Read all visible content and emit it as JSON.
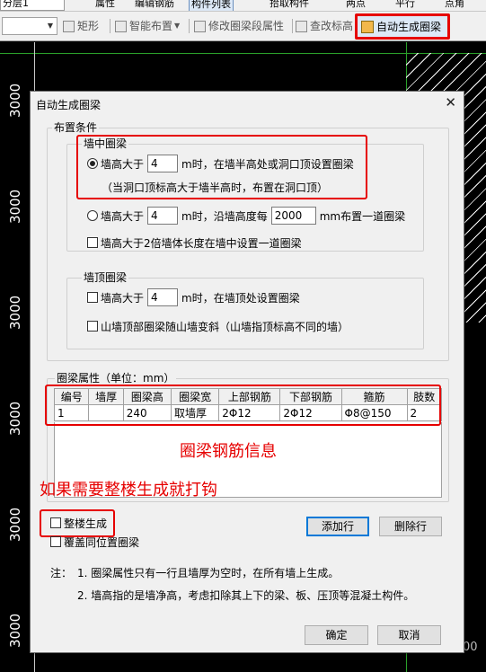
{
  "toolbar_top": {
    "floor_select": "分层1",
    "items": [
      "属性",
      "编辑钢筋",
      "构件列表",
      "拾取构件",
      "两点",
      "平行",
      "点角"
    ]
  },
  "toolbar_main": {
    "style_combo_value": "",
    "rect_label": "矩形",
    "smart_place_label": "智能布置",
    "modify_segment_label": "修改圈梁段属性",
    "view_elev_label": "查改标高",
    "auto_generate_label": "自动生成圈梁"
  },
  "cad": {
    "dim_labels": [
      "3000",
      "3000",
      "3000",
      "3000",
      "3000",
      "3000"
    ],
    "corner_label": "00"
  },
  "dialog": {
    "title": "自动生成圈梁",
    "close_glyph": "✕",
    "layout_group_label": "布置条件",
    "mid_wall": {
      "label": "墙中圈梁",
      "opt1_prefix": "墙高大于",
      "opt1_value": "4",
      "opt1_suffix": "m时，在墙半高处或洞口顶设置圈梁",
      "opt1_note": "（当洞口顶标高大于墙半高时，布置在洞口顶）",
      "opt2_prefix": "墙高大于",
      "opt2_value": "4",
      "opt2_mid": "m时，沿墙高度每",
      "opt2_value2": "2000",
      "opt2_suffix": "mm布置一道圈梁",
      "check_label": "墙高大于2倍墙体长度在墙中设置一道圈梁"
    },
    "top_wall": {
      "label": "墙顶圈梁",
      "check1_prefix": "墙高大于",
      "check1_value": "4",
      "check1_suffix": "m时，在墙顶处设置圈梁",
      "check2_label": "山墙顶部圈梁随山墙变斜（山墙指顶标高不同的墙）"
    },
    "props": {
      "label": "圈梁属性（单位：mm）",
      "headers": [
        "编号",
        "墙厚",
        "圈梁高",
        "圈梁宽",
        "上部钢筋",
        "下部钢筋",
        "箍筋",
        "肢数"
      ],
      "row": [
        "1",
        "",
        "240",
        "取墙厚",
        "2Φ12",
        "2Φ12",
        "Φ8@150",
        "2"
      ],
      "annotation": "圈梁钢筋信息"
    },
    "whole_note": "如果需要整楼生成就打钩",
    "whole_building_label": "整楼生成",
    "cover_label": "覆盖同位置圈梁",
    "add_row_label": "添加行",
    "delete_row_label": "删除行",
    "note_prefix": "注：",
    "note1": "1. 圈梁属性只有一行且墙厚为空时，在所有墙上生成。",
    "note2": "2. 墙高指的是墙净高，考虑扣除其上下的梁、板、压顶等混凝土构件。",
    "ok_label": "确定",
    "cancel_label": "取消"
  }
}
